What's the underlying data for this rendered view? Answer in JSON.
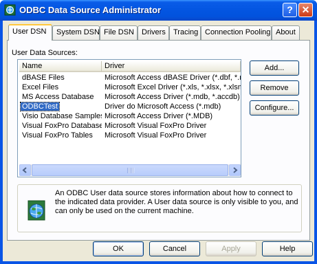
{
  "window": {
    "title": "ODBC Data Source Administrator",
    "app_icon": "odbc-icon",
    "help_glyph": "?",
    "close_glyph": "✕"
  },
  "tabs": [
    {
      "label": "User DSN",
      "active": true
    },
    {
      "label": "System DSN"
    },
    {
      "label": "File DSN"
    },
    {
      "label": "Drivers"
    },
    {
      "label": "Tracing"
    },
    {
      "label": "Connection Pooling"
    },
    {
      "label": "About"
    }
  ],
  "user_dsn": {
    "section_label": "User Data Sources:",
    "columns": {
      "name": "Name",
      "driver": "Driver"
    },
    "rows": [
      {
        "name": "dBASE Files",
        "driver": "Microsoft Access dBASE Driver (*.dbf, *.n"
      },
      {
        "name": "Excel Files",
        "driver": "Microsoft Excel Driver (*.xls, *.xlsx, *.xlsm,"
      },
      {
        "name": "MS Access Database",
        "driver": "Microsoft Access Driver (*.mdb, *.accdb)"
      },
      {
        "name": "ODBCTest",
        "driver": "Driver do Microsoft Access (*.mdb)",
        "selected": true
      },
      {
        "name": "Visio Database Samples",
        "driver": "Microsoft Access Driver (*.MDB)"
      },
      {
        "name": "Visual FoxPro Database",
        "driver": "Microsoft Visual FoxPro Driver"
      },
      {
        "name": "Visual FoxPro Tables",
        "driver": "Microsoft Visual FoxPro Driver"
      }
    ],
    "buttons": {
      "add": "Add...",
      "remove": "Remove",
      "configure": "Configure..."
    },
    "info_text": "An ODBC User data source stores information about how to connect to the indicated data provider.   A User data source is only visible to you, and can only be used on the current machine."
  },
  "footer": {
    "ok": "OK",
    "cancel": "Cancel",
    "apply": "Apply",
    "help": "Help"
  }
}
